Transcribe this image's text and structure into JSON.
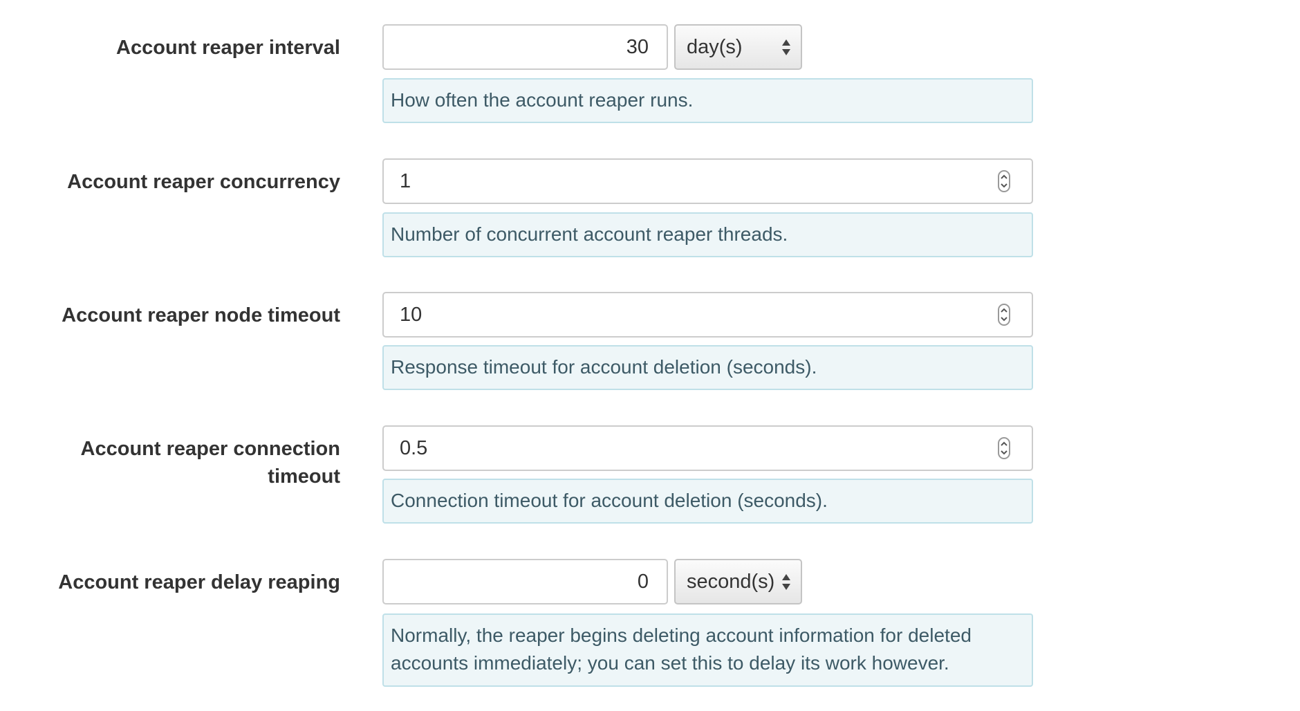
{
  "settings": {
    "interval": {
      "label": "Account reaper interval",
      "value": "30",
      "unit": "day(s)",
      "help": "How often the account reaper runs."
    },
    "concurrency": {
      "label": "Account reaper concurrency",
      "value": "1",
      "help": "Number of concurrent account reaper threads."
    },
    "node_timeout": {
      "label": "Account reaper node timeout",
      "value": "10",
      "help": "Response timeout for account deletion (seconds)."
    },
    "conn_timeout": {
      "label_line1": "Account reaper connection",
      "label_line2": "timeout",
      "value": "0.5",
      "help": "Connection timeout for account deletion (seconds)."
    },
    "delay_reaping": {
      "label": "Account reaper delay reaping",
      "value": "0",
      "unit": "second(s)",
      "help_line1": "Normally, the reaper begins deleting account information for deleted",
      "help_line2": "accounts immediately; you can set this to delay its work however."
    }
  },
  "icons": {
    "select_arrows": "updown-triangles-icon",
    "spinner": "number-spinner-icon"
  },
  "colors": {
    "help_background": "#eef6f8",
    "help_border": "#bfe0e8",
    "help_text": "#3d5a66"
  }
}
